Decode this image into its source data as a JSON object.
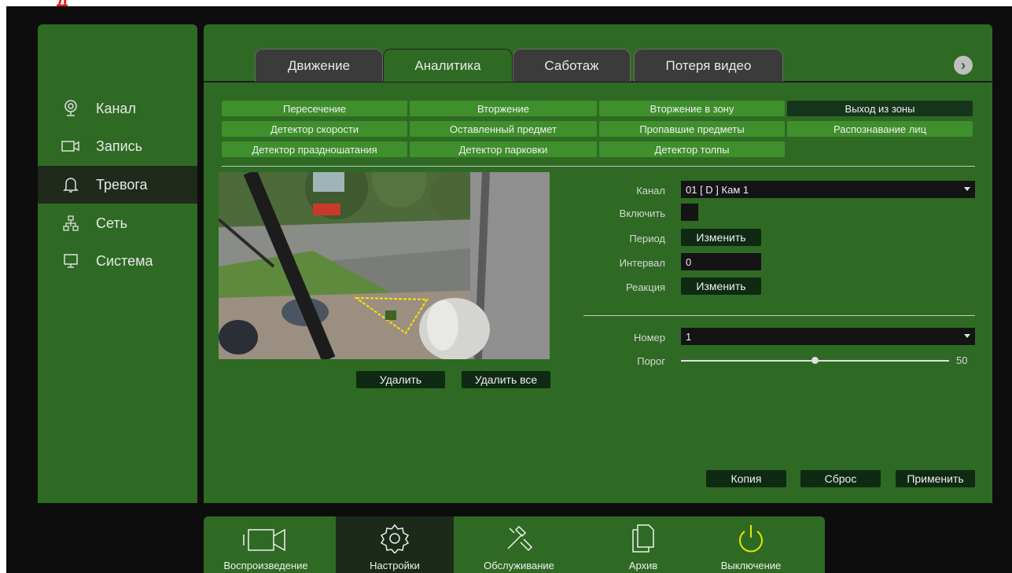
{
  "sidebar": {
    "items": [
      {
        "label": "Канал",
        "icon": "webcam-icon"
      },
      {
        "label": "Запись",
        "icon": "video-camera-icon"
      },
      {
        "label": "Тревога",
        "icon": "bell-icon"
      },
      {
        "label": "Сеть",
        "icon": "network-icon"
      },
      {
        "label": "Система",
        "icon": "monitor-icon"
      }
    ]
  },
  "tabs": [
    {
      "label": "Движение"
    },
    {
      "label": "Аналитика"
    },
    {
      "label": "Саботаж"
    },
    {
      "label": "Потеря видео"
    }
  ],
  "analytics": [
    "Пересечение",
    "Вторжение",
    "Вторжение в зону",
    "Выход из зоны",
    "Детектор скорости",
    "Оставленный предмет",
    "Пропавшие предметы",
    "Распознавание лиц",
    "Детектор праздношатания",
    "Детектор парковки",
    "Детектор толпы"
  ],
  "video_actions": {
    "delete": "Удалить",
    "delete_all": "Удалить все"
  },
  "form": {
    "channel_label": "Канал",
    "channel_value": "01 [ D ] Кам 1",
    "enable_label": "Включить",
    "period_label": "Период",
    "period_button": "Изменить",
    "interval_label": "Интервал",
    "interval_value": "0",
    "reaction_label": "Реакция",
    "reaction_button": "Изменить",
    "number_label": "Номер",
    "number_value": "1",
    "threshold_label": "Порог",
    "threshold_value": "50"
  },
  "footer_buttons": {
    "copy": "Копия",
    "reset": "Сброс",
    "apply": "Применить"
  },
  "dock": [
    {
      "label": "Воспроизведение"
    },
    {
      "label": "Настройки"
    },
    {
      "label": "Обслуживание"
    },
    {
      "label": "Архив"
    },
    {
      "label": "Выключение"
    }
  ],
  "colors": {
    "panel_green": "#2e6a23",
    "button_green": "#3f8f2c",
    "dark_button": "#0f2a12",
    "power_yellow": "#e6e600"
  }
}
